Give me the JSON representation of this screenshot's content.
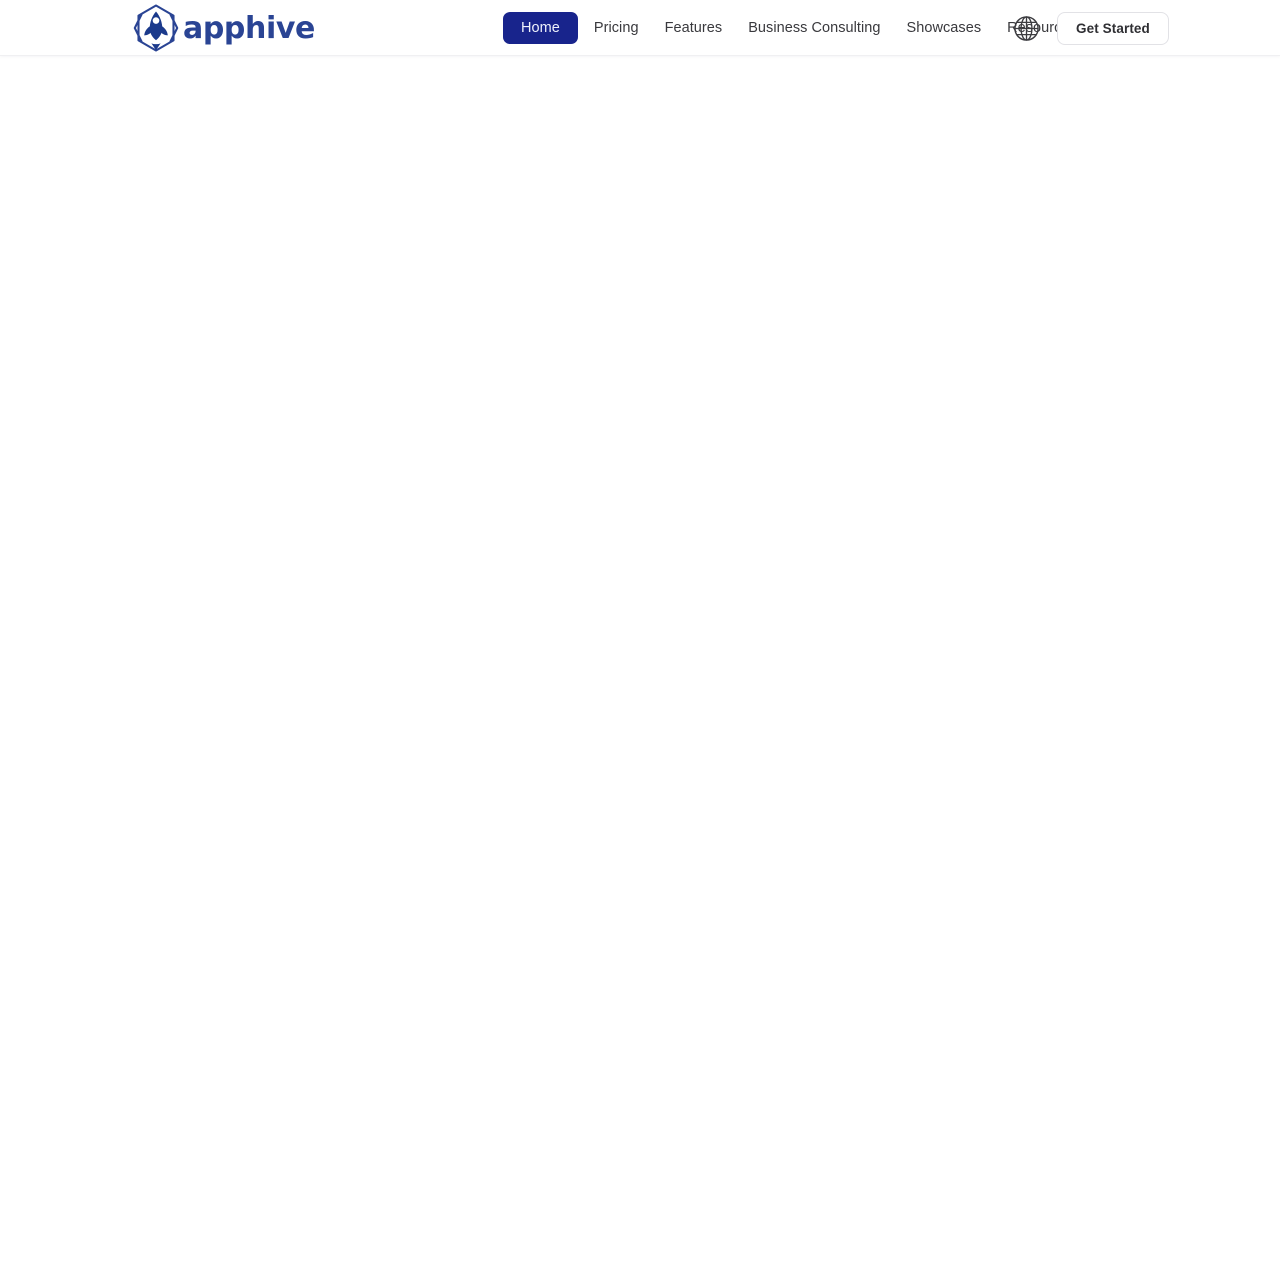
{
  "page": {
    "background_color": "#ffffff",
    "body_content": ""
  },
  "header": {
    "background_color": "#ffffff",
    "border_color": "#f0f0f2",
    "brand": {
      "logo_icon": "rocket-hexagon-logo-icon",
      "wordmark": "apphive",
      "brand_color": "#2a4494"
    },
    "nav": {
      "items": [
        {
          "label": "Home",
          "active": true
        },
        {
          "label": "Pricing",
          "active": false
        },
        {
          "label": "Features",
          "active": false
        },
        {
          "label": "Business Consulting",
          "active": false
        },
        {
          "label": "Showcases",
          "active": false
        },
        {
          "label": "Resources",
          "active": false
        }
      ],
      "active_background_color": "#18248c",
      "active_text_color": "#eef1fb",
      "text_color": "#39393d"
    },
    "actions": {
      "language_icon": "globe-icon",
      "cta_label": "Get Started",
      "cta_border_color": "#e2e2e6",
      "cta_text_color": "#2f2f33"
    }
  }
}
